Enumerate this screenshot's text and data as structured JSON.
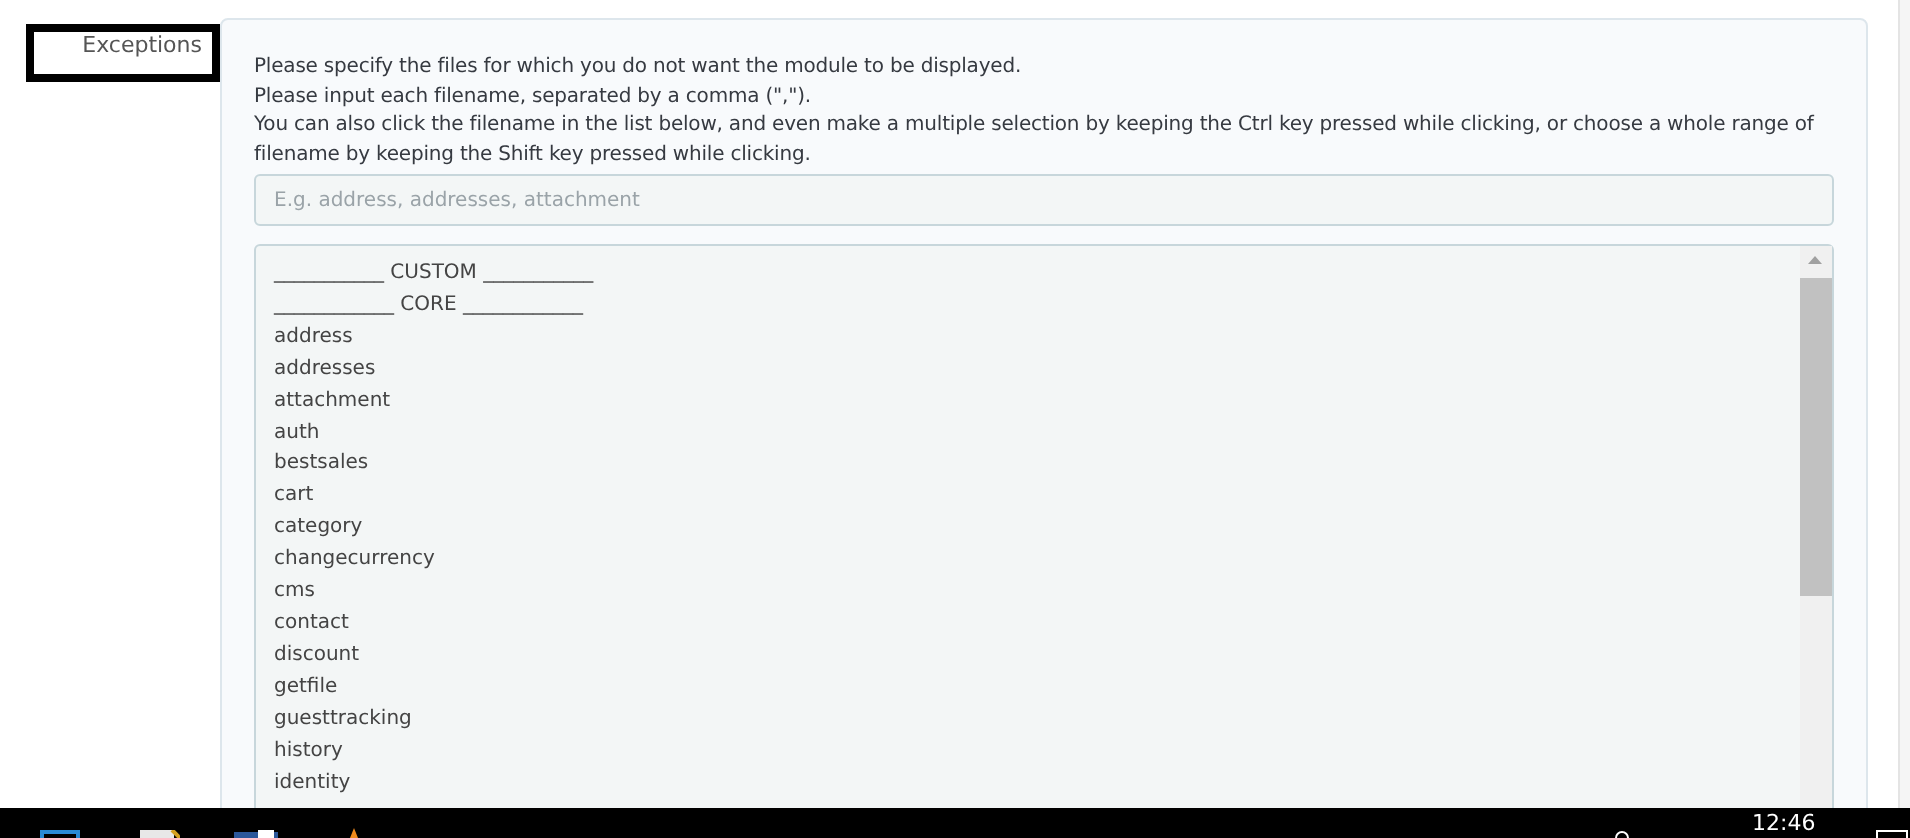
{
  "field_label": "Exceptions",
  "instructions": [
    "Please specify the files for which you do not want the module to be displayed.",
    "Please input each filename, separated by a comma (\",\").",
    "You can also click the filename in the list below, and even make a multiple selection by keeping the Ctrl key pressed while clicking, or choose a whole range of filename by keeping the Shift key pressed while clicking."
  ],
  "filename_field": {
    "placeholder": "E.g. address, addresses, attachment"
  },
  "file_list": [
    "___________ CUSTOM ___________",
    "____________ CORE ____________",
    "address",
    "addresses",
    "attachment",
    "auth",
    "bestsales",
    "cart",
    "category",
    "changecurrency",
    "cms",
    "contact",
    "discount",
    "getfile",
    "guesttracking",
    "history",
    "identity"
  ],
  "taskbar": {
    "clock": "12:46"
  }
}
